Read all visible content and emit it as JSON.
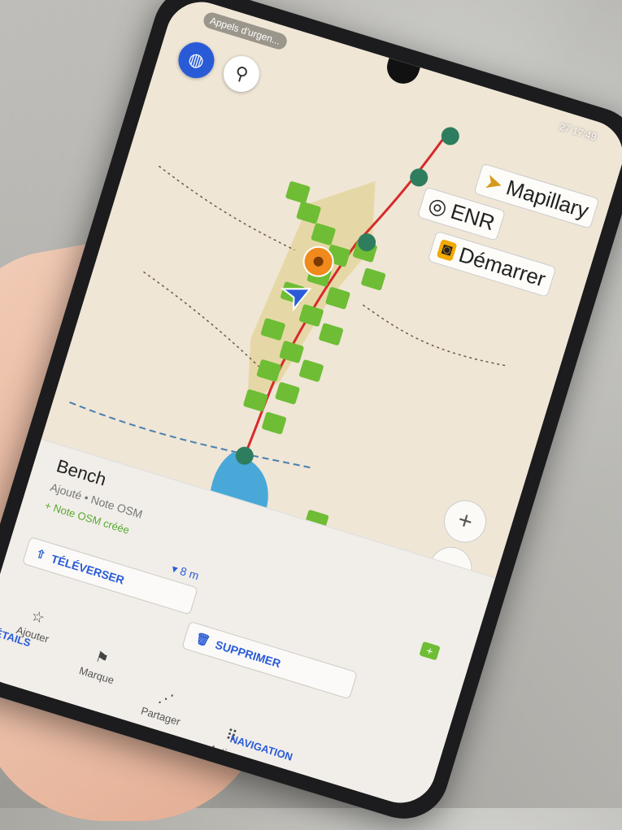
{
  "status": {
    "notification": "Appels d'urgen...",
    "time": "17:49",
    "battery": "27"
  },
  "map_layers": {
    "mapillary_label": "Mapillary",
    "enr_label": "ENR",
    "record_label": "Démarrer"
  },
  "map_controls": {
    "zoom_in": "+",
    "zoom_out": "−"
  },
  "place": {
    "title": "Bench",
    "subtitle": "Ajouté • Note OSM",
    "note": "+ Note OSM créée",
    "distance": "▾ 8 m"
  },
  "actions": {
    "upload_label": "TÉLÉVERSER",
    "delete_label": "SUPPRIMER"
  },
  "tabs": [
    {
      "label": "Ajouter",
      "icon": "☆"
    },
    {
      "label": "Marque",
      "icon": "⚑"
    },
    {
      "label": "Partager",
      "icon": "⋰"
    },
    {
      "label": "Actions",
      "icon": "⠿"
    }
  ],
  "links": {
    "details": "DÉTAILS",
    "navigation": "NAVIGATION"
  },
  "colors": {
    "accent_blue": "#2a5bd7",
    "marker_green": "#6ebd35",
    "route_red": "#d62b2b",
    "poi_orange": "#f08a1c",
    "water_blue": "#49a8d8"
  }
}
